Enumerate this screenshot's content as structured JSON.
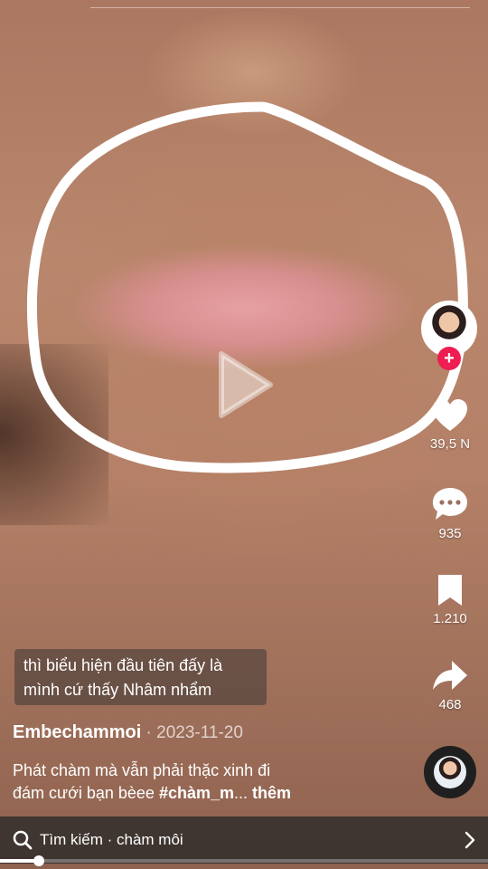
{
  "caption": {
    "line1": "thì biểu hiện đầu tiên đấy là",
    "line2": "mình cứ thấy Nhâm nhẩm"
  },
  "author": {
    "name": "Embechammoi",
    "separator": " · ",
    "date": "2023-11-20"
  },
  "description": {
    "line1": "Phát chàm mà vẫn phải thặc xinh đi",
    "line2_text": "đám cưới bạn bèee  ",
    "hashtag": "#chàm_m",
    "ellipsis": "...",
    "more": " thêm"
  },
  "actions": {
    "likes": "39,5 N",
    "comments": "935",
    "saves": "1.210",
    "shares": "468"
  },
  "follow_symbol": "+",
  "search": {
    "label": "Tìm kiếm · chàm môi"
  },
  "progress": 0.08,
  "icons": [
    "play-icon",
    "heart-icon",
    "comment-icon",
    "bookmark-icon",
    "share-icon",
    "search-icon",
    "chevron-right-icon"
  ],
  "colors": {
    "follow": "#ee1d52",
    "circle": "#ffffff"
  }
}
